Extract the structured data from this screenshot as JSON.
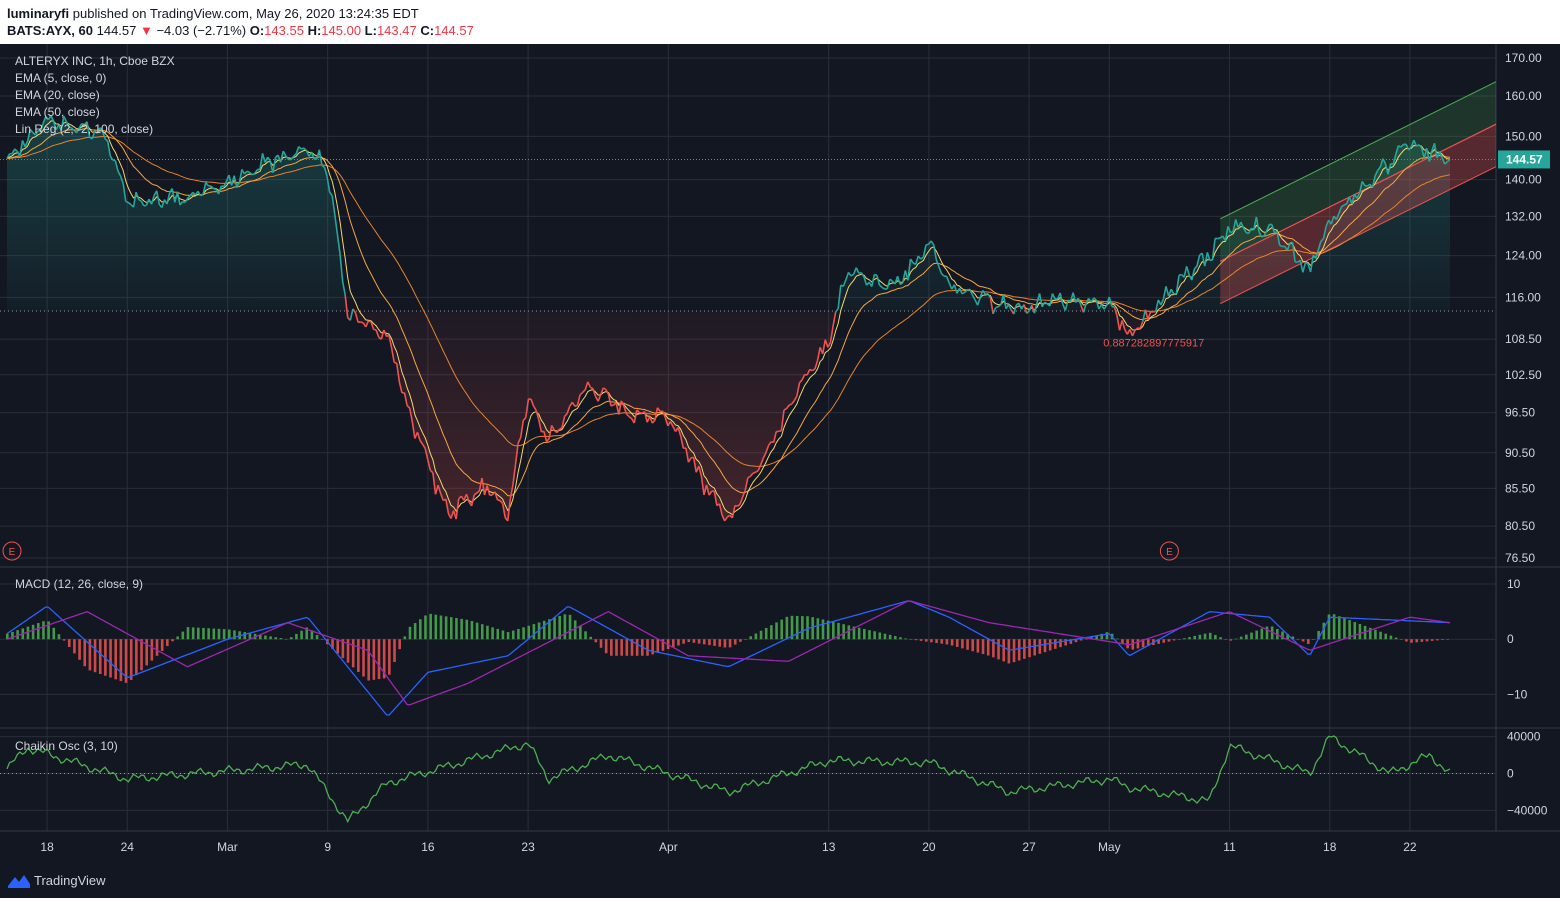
{
  "header": {
    "author": "luminaryfi",
    "published_text": "published on TradingView.com, May 26, 2020 13:24:35 EDT",
    "symbol": "BATS:AYX, 60",
    "last": "144.57",
    "change": "−4.03 (−2.71%)",
    "o_label": "O:",
    "o": "143.55",
    "h_label": "H:",
    "h": "145.00",
    "l_label": "L:",
    "l": "143.47",
    "c_label": "C:",
    "c": "144.57"
  },
  "footer": {
    "brand": "TradingView"
  },
  "colors": {
    "background": "#131722",
    "grid": "#2a2e39",
    "text": "#d1d4dc",
    "bull": "#26a69a",
    "bear": "#ef5350",
    "ema_fast": "#f5d76e",
    "ema_mid": "#f7a440",
    "ema_slow": "#e8822b",
    "macd": "#2962ff",
    "signal": "#9c27b0",
    "hist_pos": "#4caf50",
    "hist_neg": "#ef5350",
    "chaikin": "#4caf50"
  },
  "chart_data": [
    {
      "type": "line",
      "pane": "price",
      "legend": [
        "ALTERYX INC, 1h, Cboe BZX",
        "EMA (5, close, 0)",
        "EMA (20, close)",
        "EMA (50, close)",
        "Lin Reg (2, -2, 100, close)"
      ],
      "x_ticks": [
        "18",
        "24",
        "Mar",
        "9",
        "16",
        "23",
        "Apr",
        "13",
        "20",
        "27",
        "May",
        "11",
        "18",
        "22"
      ],
      "y_ticks": [
        "170.00",
        "160.00",
        "150.00",
        "140.00",
        "132.00",
        "124.00",
        "116.00",
        "108.50",
        "102.50",
        "96.50",
        "90.50",
        "85.50",
        "80.50",
        "76.50"
      ],
      "last_price": "144.57",
      "reference_level": 113.5,
      "annotation": "0.887282897775917",
      "earnings_markers": [
        "E",
        "E"
      ],
      "close_series": [
        {
          "x": "Feb 14",
          "y": 145
        },
        {
          "x": "Feb 18",
          "y": 154
        },
        {
          "x": "Feb 21",
          "y": 150
        },
        {
          "x": "Feb 24",
          "y": 135
        },
        {
          "x": "Feb 27",
          "y": 136
        },
        {
          "x": "Mar 2",
          "y": 139
        },
        {
          "x": "Mar 4",
          "y": 144
        },
        {
          "x": "Mar 6",
          "y": 147
        },
        {
          "x": "Mar 9",
          "y": 142
        },
        {
          "x": "Mar 10",
          "y": 113
        },
        {
          "x": "Mar 12",
          "y": 109
        },
        {
          "x": "Mar 13",
          "y": 97
        },
        {
          "x": "Mar 16",
          "y": 89
        },
        {
          "x": "Mar 17",
          "y": 82
        },
        {
          "x": "Mar 19",
          "y": 86
        },
        {
          "x": "Mar 20",
          "y": 82
        },
        {
          "x": "Mar 23",
          "y": 99
        },
        {
          "x": "Mar 24",
          "y": 92
        },
        {
          "x": "Mar 26",
          "y": 101
        },
        {
          "x": "Mar 27",
          "y": 99
        },
        {
          "x": "Mar 30",
          "y": 96
        },
        {
          "x": "Apr 1",
          "y": 96
        },
        {
          "x": "Apr 3",
          "y": 85
        },
        {
          "x": "Apr 6",
          "y": 81
        },
        {
          "x": "Apr 8",
          "y": 91
        },
        {
          "x": "Apr 10",
          "y": 103
        },
        {
          "x": "Apr 13",
          "y": 108
        },
        {
          "x": "Apr 14",
          "y": 121
        },
        {
          "x": "Apr 16",
          "y": 118
        },
        {
          "x": "Apr 17",
          "y": 121
        },
        {
          "x": "Apr 20",
          "y": 127
        },
        {
          "x": "Apr 21",
          "y": 118
        },
        {
          "x": "Apr 24",
          "y": 114
        },
        {
          "x": "Apr 28",
          "y": 115
        },
        {
          "x": "May 1",
          "y": 115
        },
        {
          "x": "May 4",
          "y": 109
        },
        {
          "x": "May 6",
          "y": 117
        },
        {
          "x": "May 8",
          "y": 124
        },
        {
          "x": "May 11",
          "y": 130
        },
        {
          "x": "May 13",
          "y": 129
        },
        {
          "x": "May 15",
          "y": 121
        },
        {
          "x": "May 18",
          "y": 131
        },
        {
          "x": "May 20",
          "y": 140
        },
        {
          "x": "May 22",
          "y": 148
        },
        {
          "x": "May 26",
          "y": 144.57
        }
      ]
    },
    {
      "type": "line",
      "pane": "macd",
      "legend": [
        "MACD (12, 26, close, 9)"
      ],
      "y_ticks": [
        "10",
        "0",
        "−10"
      ],
      "macd": [
        {
          "x": "Feb 14",
          "y": 1
        },
        {
          "x": "Feb 18",
          "y": 6
        },
        {
          "x": "Feb 24",
          "y": -7
        },
        {
          "x": "Mar 2",
          "y": 0
        },
        {
          "x": "Mar 6",
          "y": 4
        },
        {
          "x": "Mar 10",
          "y": -5
        },
        {
          "x": "Mar 12",
          "y": -14
        },
        {
          "x": "Mar 16",
          "y": -6
        },
        {
          "x": "Mar 20",
          "y": -3
        },
        {
          "x": "Mar 25",
          "y": 6
        },
        {
          "x": "Mar 31",
          "y": -2
        },
        {
          "x": "Apr 6",
          "y": -5
        },
        {
          "x": "Apr 10",
          "y": 2
        },
        {
          "x": "Apr 17",
          "y": 7
        },
        {
          "x": "Apr 21",
          "y": 4
        },
        {
          "x": "Apr 24",
          "y": -2
        },
        {
          "x": "May 1",
          "y": 1
        },
        {
          "x": "May 4",
          "y": -3
        },
        {
          "x": "May 8",
          "y": 5
        },
        {
          "x": "May 13",
          "y": 4
        },
        {
          "x": "May 15",
          "y": -3
        },
        {
          "x": "May 18",
          "y": 4
        },
        {
          "x": "May 26",
          "y": 3
        }
      ],
      "signal": [
        {
          "x": "Feb 14",
          "y": 0
        },
        {
          "x": "Feb 20",
          "y": 5
        },
        {
          "x": "Feb 27",
          "y": -5
        },
        {
          "x": "Mar 5",
          "y": 3
        },
        {
          "x": "Mar 11",
          "y": -2
        },
        {
          "x": "Mar 13",
          "y": -12
        },
        {
          "x": "Mar 18",
          "y": -8
        },
        {
          "x": "Mar 27",
          "y": 5
        },
        {
          "x": "Apr 2",
          "y": -3
        },
        {
          "x": "Apr 9",
          "y": -4
        },
        {
          "x": "Apr 17",
          "y": 7
        },
        {
          "x": "Apr 23",
          "y": 3
        },
        {
          "x": "May 4",
          "y": -1
        },
        {
          "x": "May 10",
          "y": 5
        },
        {
          "x": "May 15",
          "y": -2
        },
        {
          "x": "May 22",
          "y": 4
        },
        {
          "x": "May 26",
          "y": 3
        }
      ]
    },
    {
      "type": "area",
      "pane": "chaikin",
      "legend": [
        "Chaikin Osc (3, 10)"
      ],
      "y_ticks": [
        "40000",
        "0",
        "−40000"
      ],
      "values": [
        {
          "x": "Feb 14",
          "y": 5000
        },
        {
          "x": "Feb 17",
          "y": 28000
        },
        {
          "x": "Feb 24",
          "y": -6000
        },
        {
          "x": "Mar 6",
          "y": 10000
        },
        {
          "x": "Mar 10",
          "y": -52000
        },
        {
          "x": "Mar 12",
          "y": -10000
        },
        {
          "x": "Mar 17",
          "y": 8000
        },
        {
          "x": "Mar 21",
          "y": 33000
        },
        {
          "x": "Mar 24",
          "y": -6000
        },
        {
          "x": "Mar 27",
          "y": 20000
        },
        {
          "x": "Apr 1",
          "y": 0
        },
        {
          "x": "Apr 6",
          "y": -20000
        },
        {
          "x": "Apr 13",
          "y": 14000
        },
        {
          "x": "Apr 20",
          "y": 12000
        },
        {
          "x": "Apr 24",
          "y": -20000
        },
        {
          "x": "May 1",
          "y": -6000
        },
        {
          "x": "May 4",
          "y": -15000
        },
        {
          "x": "May 8",
          "y": -30000
        },
        {
          "x": "May 11",
          "y": 30000
        },
        {
          "x": "May 15",
          "y": 0
        },
        {
          "x": "May 18",
          "y": 40000
        },
        {
          "x": "May 21",
          "y": 0
        },
        {
          "x": "May 24",
          "y": 20000
        },
        {
          "x": "May 26",
          "y": 0
        }
      ]
    }
  ]
}
